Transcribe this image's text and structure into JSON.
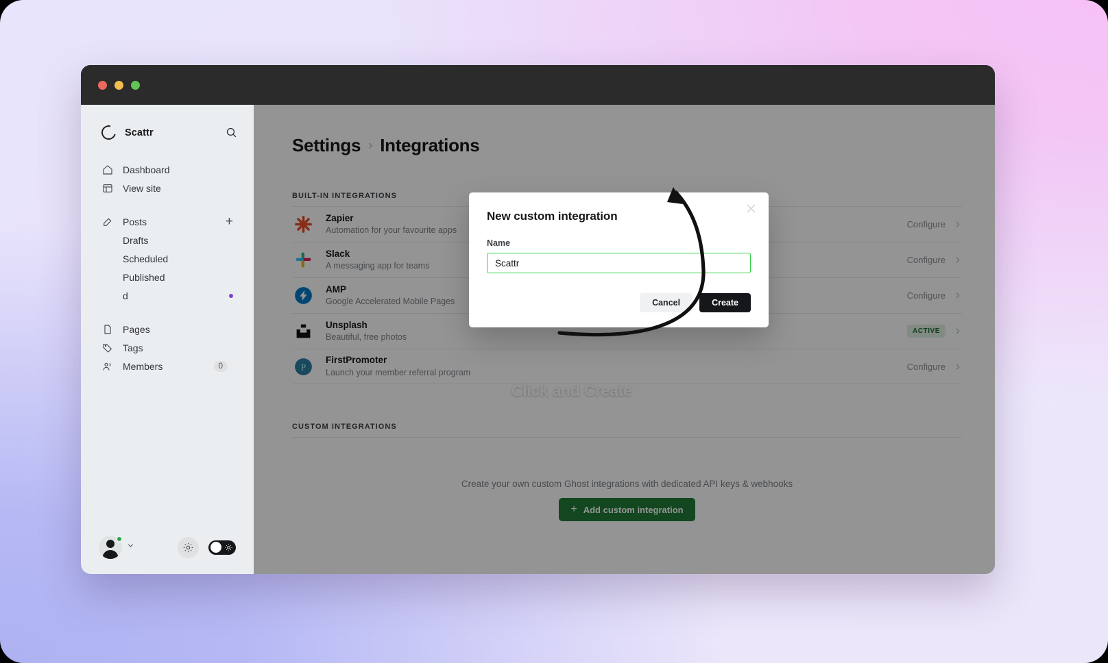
{
  "window": {
    "traffic_lights": [
      "close",
      "minimize",
      "zoom"
    ]
  },
  "sidebar": {
    "brand": {
      "name": "Scattr",
      "logo_icon": "ghost-circle-icon"
    },
    "search_icon": "search-icon",
    "nav_primary": [
      {
        "label": "Dashboard",
        "icon": "home-icon"
      },
      {
        "label": "View site",
        "icon": "browser-icon"
      }
    ],
    "posts_group": {
      "label": "Posts",
      "icon": "pencil-square-icon",
      "add_icon": "plus-icon",
      "children": [
        {
          "label": "Drafts"
        },
        {
          "label": "Scheduled"
        },
        {
          "label": "Published"
        },
        {
          "label": "d",
          "marker": "unsaved-dot"
        }
      ]
    },
    "nav_secondary": [
      {
        "label": "Pages",
        "icon": "page-icon",
        "count": ""
      },
      {
        "label": "Tags",
        "icon": "tag-icon",
        "count": ""
      },
      {
        "label": "Members",
        "icon": "members-icon",
        "count": "0"
      }
    ],
    "footer": {
      "avatar_icon": "user-avatar",
      "presence": "online",
      "chevron_icon": "chevron-down-icon",
      "settings_icon": "gear-icon",
      "theme_toggle": {
        "icon": "sun-icon",
        "state": "off"
      }
    }
  },
  "main": {
    "breadcrumb": {
      "root": "Settings",
      "separator": "›",
      "current": "Integrations"
    },
    "builtin": {
      "section_label": "Built-in integrations",
      "rows": [
        {
          "name": "Zapier",
          "desc": "Automation for your favourite apps",
          "logo": "zapier-icon",
          "action": "Configure",
          "status": ""
        },
        {
          "name": "Slack",
          "desc": "A messaging app for teams",
          "logo": "slack-icon",
          "action": "Configure",
          "status": ""
        },
        {
          "name": "AMP",
          "desc": "Google Accelerated Mobile Pages",
          "logo": "amp-icon",
          "action": "Configure",
          "status": ""
        },
        {
          "name": "Unsplash",
          "desc": "Beautiful, free photos",
          "logo": "unsplash-icon",
          "action": "",
          "status": "ACTIVE"
        },
        {
          "name": "FirstPromoter",
          "desc": "Launch your member referral program",
          "logo": "firstpromoter-icon",
          "action": "Configure",
          "status": ""
        }
      ]
    },
    "custom": {
      "section_label": "Custom integrations",
      "empty_text": "Create your own custom Ghost integrations with dedicated API keys & webhooks",
      "add_button": {
        "label": "Add custom integration",
        "icon": "plus-icon"
      }
    }
  },
  "modal": {
    "title": "New custom integration",
    "close_icon": "close-icon",
    "field": {
      "label": "Name",
      "value": "Scattr",
      "placeholder": ""
    },
    "cancel_label": "Cancel",
    "create_label": "Create"
  },
  "annotation": {
    "text": "Click and Create",
    "arrow": "curved-arrow-to-create-button"
  },
  "colors": {
    "accent_green": "#1f7a38",
    "input_focus_green": "#30cf43",
    "active_badge_bg": "#dfeee2",
    "active_badge_text": "#1c6b33",
    "dark": "#15171a"
  }
}
